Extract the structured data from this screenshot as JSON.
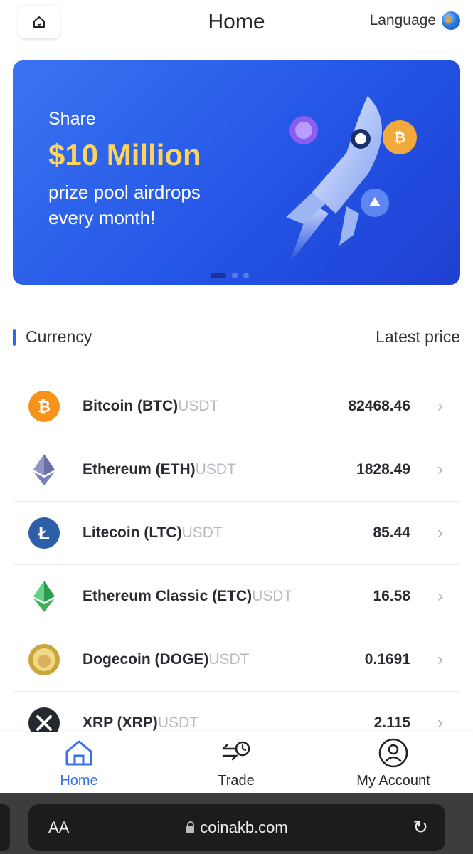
{
  "header": {
    "title": "Home",
    "language_label": "Language"
  },
  "banner": {
    "line1": "Share",
    "amount": "$10 Million",
    "line2": "prize pool airdrops",
    "line3": "every month!",
    "colors": {
      "background": "#2456e6",
      "amount": "#ffd45a"
    }
  },
  "list": {
    "left_header": "Currency",
    "right_header": "Latest price",
    "rows": [
      {
        "name": "Bitcoin (BTC)",
        "quote": "USDT",
        "price": "82468.46",
        "icon": "bitcoin-icon"
      },
      {
        "name": "Ethereum (ETH)",
        "quote": "USDT",
        "price": "1828.49",
        "icon": "ethereum-icon"
      },
      {
        "name": "Litecoin (LTC)",
        "quote": "USDT",
        "price": "85.44",
        "icon": "litecoin-icon"
      },
      {
        "name": "Ethereum Classic (ETC)",
        "quote": "USDT",
        "price": "16.58",
        "icon": "ethereum-classic-icon"
      },
      {
        "name": "Dogecoin (DOGE)",
        "quote": "USDT",
        "price": "0.1691",
        "icon": "dogecoin-icon"
      },
      {
        "name": "XRP (XRP)",
        "quote": "USDT",
        "price": "2.115",
        "icon": "xrp-icon"
      }
    ]
  },
  "nav": {
    "home": "Home",
    "trade": "Trade",
    "account": "My Account",
    "active_color": "#3b6fea"
  },
  "browser": {
    "text_size": "AA",
    "url": "coinakb.com"
  }
}
